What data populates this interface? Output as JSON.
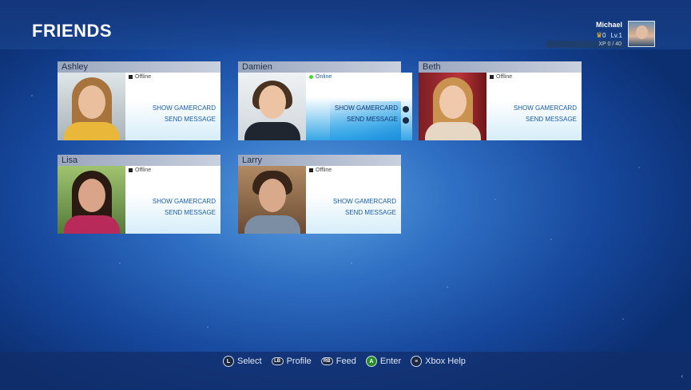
{
  "header": {
    "title": "FRIENDS",
    "user": {
      "name": "Michael",
      "score": "0",
      "level": "Lv.1",
      "xp": "XP 0 / 40"
    }
  },
  "friends": [
    {
      "name": "Ashley",
      "status": "Offline",
      "actions": [
        "SHOW GAMERCARD",
        "SEND MESSAGE"
      ]
    },
    {
      "name": "Damien",
      "status": "Online",
      "actions": [
        "SHOW GAMERCARD",
        "SEND MESSAGE"
      ]
    },
    {
      "name": "Beth",
      "status": "Offline",
      "actions": [
        "SHOW GAMERCARD",
        "SEND MESSAGE"
      ]
    },
    {
      "name": "Lisa",
      "status": "Offline",
      "actions": [
        "SHOW GAMERCARD",
        "SEND MESSAGE"
      ]
    },
    {
      "name": "Larry",
      "status": "Offline",
      "actions": [
        "SHOW GAMERCARD",
        "SEND MESSAGE"
      ]
    }
  ],
  "footer": {
    "hints": [
      {
        "button": "L",
        "label": "Select"
      },
      {
        "button": "LB",
        "label": "Profile"
      },
      {
        "button": "RB",
        "label": "Feed"
      },
      {
        "button": "A",
        "label": "Enter"
      },
      {
        "button": "≡",
        "label": "Xbox Help"
      }
    ]
  },
  "colors": {
    "online": "#4ad63a",
    "accent": "#1d8fdc",
    "action_text": "#1b5ea3"
  }
}
